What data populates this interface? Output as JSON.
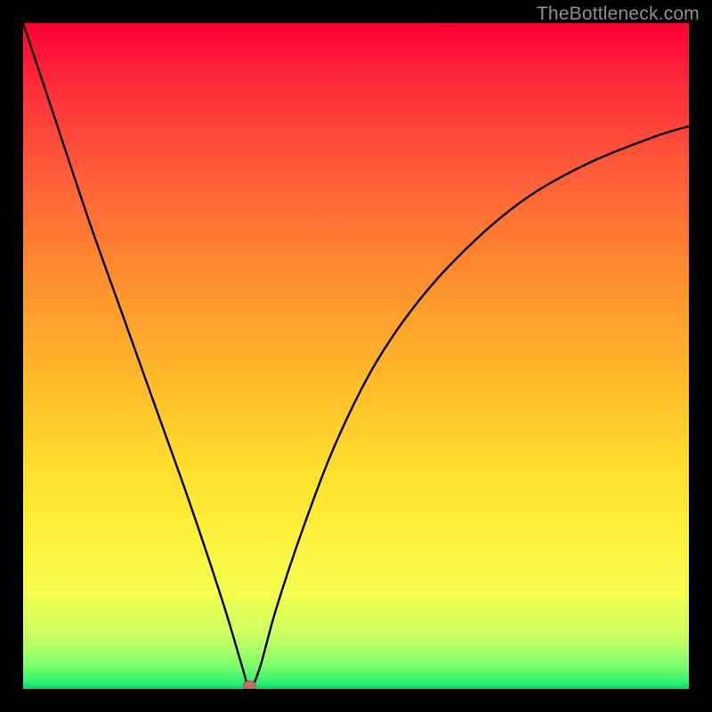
{
  "watermark": "TheBottleneck.com",
  "colors": {
    "frame": "#000000",
    "curve": "#000000",
    "marker_fill": "#c76a6f",
    "marker_stroke": "#aa5056"
  },
  "chart_data": {
    "type": "line",
    "title": "",
    "xlabel": "",
    "ylabel": "",
    "xlim": [
      0,
      100
    ],
    "ylim": [
      0,
      100
    ],
    "grid": false,
    "curve": {
      "description": "V-shaped penalty curve with minimum near x≈34; left branch roughly linear, right branch saturating",
      "points": [
        {
          "x": 0.0,
          "y": 100.0
        },
        {
          "x": 5.0,
          "y": 85.0
        },
        {
          "x": 10.0,
          "y": 70.0
        },
        {
          "x": 15.0,
          "y": 56.0
        },
        {
          "x": 20.0,
          "y": 42.0
        },
        {
          "x": 25.0,
          "y": 28.0
        },
        {
          "x": 30.0,
          "y": 13.0
        },
        {
          "x": 33.0,
          "y": 3.0
        },
        {
          "x": 34.0,
          "y": 0.0
        },
        {
          "x": 35.5,
          "y": 3.0
        },
        {
          "x": 38.0,
          "y": 12.0
        },
        {
          "x": 42.0,
          "y": 24.0
        },
        {
          "x": 47.0,
          "y": 37.0
        },
        {
          "x": 53.0,
          "y": 49.0
        },
        {
          "x": 60.0,
          "y": 59.0
        },
        {
          "x": 68.0,
          "y": 67.5
        },
        {
          "x": 76.0,
          "y": 74.0
        },
        {
          "x": 85.0,
          "y": 79.0
        },
        {
          "x": 95.0,
          "y": 83.0
        },
        {
          "x": 100.0,
          "y": 84.5
        }
      ]
    },
    "marker": {
      "x": 34.0,
      "y": 0.0
    }
  }
}
